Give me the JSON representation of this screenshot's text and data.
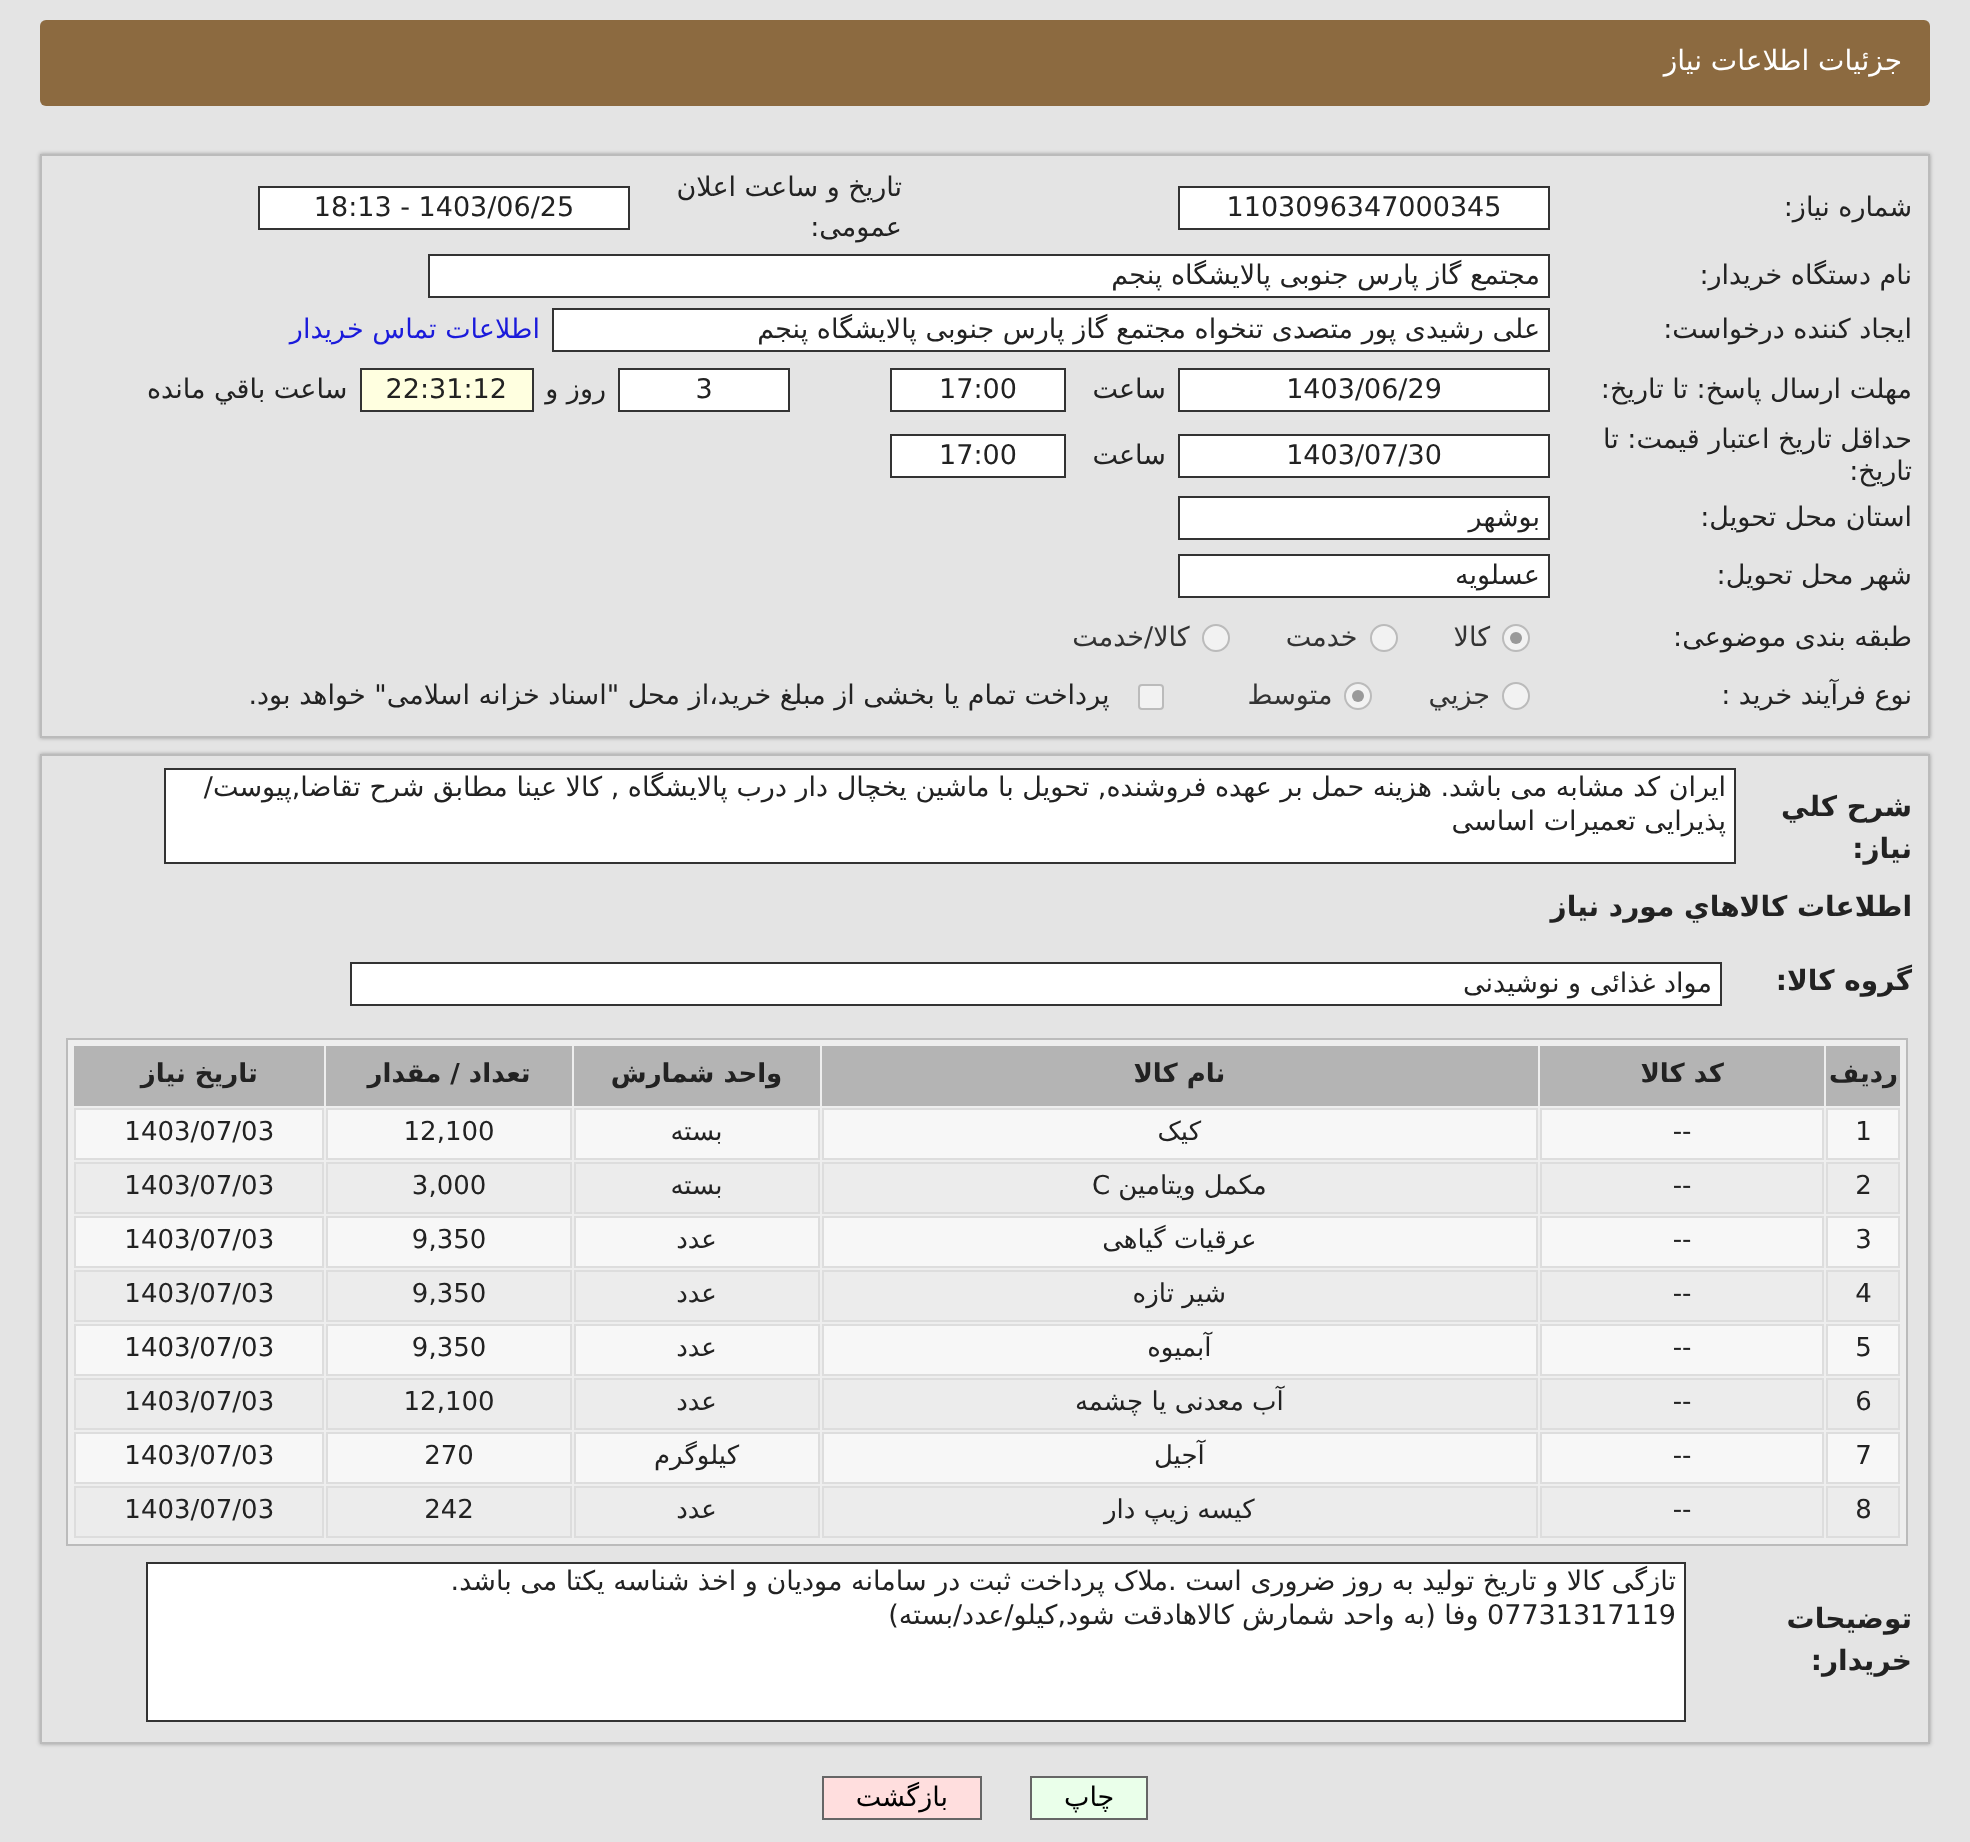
{
  "header": {
    "title": "جزئیات اطلاعات نیاز"
  },
  "need_number": {
    "label": "شماره نیاز:",
    "value": "1103096347000345"
  },
  "announce": {
    "label": "تاریخ و ساعت اعلان عمومی:",
    "value": "1403/06/25 - 18:13"
  },
  "buyer_org": {
    "label": "نام دستگاه خریدار:",
    "value": "مجتمع گاز پارس جنوبی  پالایشگاه پنجم"
  },
  "requester": {
    "label": "ایجاد کننده درخواست:",
    "value": "علی رشیدی پور متصدی تنخواه مجتمع گاز پارس جنوبی  پالایشگاه پنجم",
    "contact_link": "اطلاعات تماس خریدار"
  },
  "response_deadline": {
    "label": "مهلت ارسال پاسخ: تا تاریخ:",
    "date": "1403/06/29",
    "time_label": "ساعت",
    "time": "17:00",
    "days": "3",
    "days_label": "روز و",
    "remaining": "22:31:12",
    "remaining_label": "ساعت باقي مانده"
  },
  "price_validity": {
    "label": "حداقل تاریخ اعتبار قیمت: تا تاریخ:",
    "date": "1403/07/30",
    "time_label": "ساعت",
    "time": "17:00"
  },
  "province": {
    "label": "استان محل تحویل:",
    "value": "بوشهر"
  },
  "city": {
    "label": "شهر محل تحویل:",
    "value": "عسلویه"
  },
  "category": {
    "label": "طبقه بندی موضوعی:",
    "options": [
      {
        "label": "کالا",
        "selected": true
      },
      {
        "label": "خدمت",
        "selected": false
      },
      {
        "label": "کالا/خدمت",
        "selected": false
      }
    ]
  },
  "purchase_type": {
    "label": "نوع فرآیند خرید :",
    "options": [
      {
        "label": "جزیي",
        "selected": false
      },
      {
        "label": "متوسط",
        "selected": true
      }
    ],
    "payment_note": {
      "label": "پرداخت تمام یا بخشی از مبلغ خرید،از محل \"اسناد خزانه اسلامی\" خواهد بود.",
      "checked": false
    }
  },
  "description": {
    "label": "شرح کلي نیاز:",
    "value": "ایران کد مشابه می باشد. هزینه حمل بر عهده فروشنده, تحویل با ماشین یخچال دار درب پالایشگاه , کالا عینا مطابق شرح تقاضا,پیوست/پذیرایی تعمیرات اساسی"
  },
  "goods_heading": "اطلاعات کالاهاي مورد نیاز",
  "goods_group": {
    "label": "گروه کالا:",
    "value": "مواد غذائی و نوشیدنی"
  },
  "table": {
    "columns": [
      "ردیف",
      "کد کالا",
      "نام کالا",
      "واحد شمارش",
      "تعداد / مقدار",
      "تاریخ نیاز"
    ],
    "rows": [
      [
        "1",
        "--",
        "کیک",
        "بسته",
        "12,100",
        "1403/07/03"
      ],
      [
        "2",
        "--",
        "مکمل ویتامین C",
        "بسته",
        "3,000",
        "1403/07/03"
      ],
      [
        "3",
        "--",
        "عرقیات گیاهی",
        "عدد",
        "9,350",
        "1403/07/03"
      ],
      [
        "4",
        "--",
        "شیر تازه",
        "عدد",
        "9,350",
        "1403/07/03"
      ],
      [
        "5",
        "--",
        "آبمیوه",
        "عدد",
        "9,350",
        "1403/07/03"
      ],
      [
        "6",
        "--",
        "آب معدنی یا چشمه",
        "عدد",
        "12,100",
        "1403/07/03"
      ],
      [
        "7",
        "--",
        "آجیل",
        "کیلوگرم",
        "270",
        "1403/07/03"
      ],
      [
        "8",
        "--",
        "کیسه زیپ دار",
        "عدد",
        "242",
        "1403/07/03"
      ]
    ]
  },
  "buyer_notes": {
    "label": "توضیحات خریدار:",
    "value": "تازگی کالا و تاریخ تولید به روز ضروری است .ملاک پرداخت ثبت در سامانه مودیان و اخذ شناسه یکتا می باشد.\n07731317119 وفا (به واحد شمارش کالاهادقت شود,کیلو/عدد/بسته)"
  },
  "buttons": [
    {
      "label": "چاپ",
      "kind": "print"
    },
    {
      "label": "بازگشت",
      "kind": "back"
    }
  ]
}
